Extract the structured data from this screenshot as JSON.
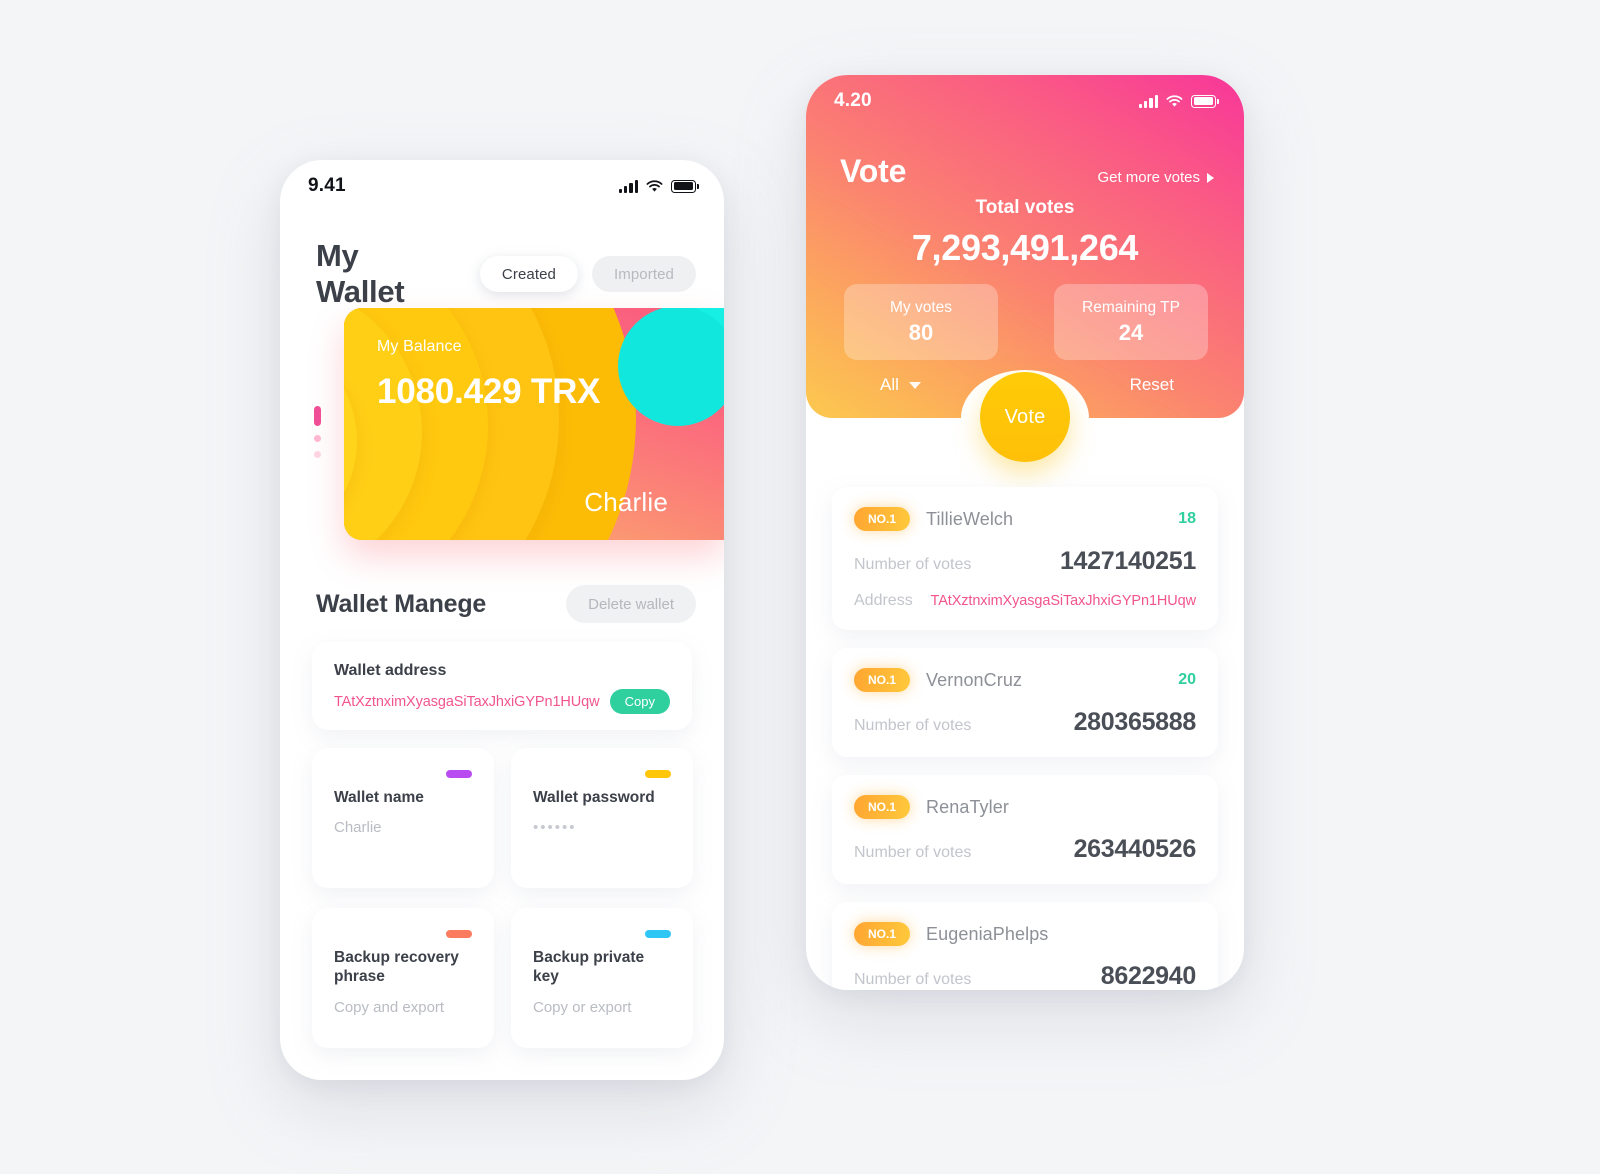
{
  "wallet_screen": {
    "status_bar": {
      "time": "9.41",
      "signal": "signal-bars-icon",
      "wifi": "wifi-icon",
      "battery": "battery-icon"
    },
    "title": "My Wallet",
    "tabs": [
      {
        "label": "Created",
        "active": true
      },
      {
        "label": "Imported",
        "active": false
      }
    ],
    "balance_card": {
      "label": "My Balance",
      "amount": "1080.429 TRX",
      "owner": "Charlie"
    },
    "pagination": {
      "total": 3,
      "active_index": 0
    },
    "manage": {
      "title": "Wallet Manege",
      "delete_label": "Delete wallet"
    },
    "address_card": {
      "label": "Wallet address",
      "value": "TAtXztnximXyasgaSiTaxJhxiGYPn1HUqw",
      "copy_label": "Copy"
    },
    "mini_cards": [
      {
        "title": "Wallet name",
        "sub": "Charlie",
        "dash_color": "#b84cf0",
        "is_password": false
      },
      {
        "title": "Wallet password",
        "sub": "••••••",
        "dash_color": "#ffc60a",
        "is_password": true
      },
      {
        "title": "Backup recovery phrase",
        "sub": "Copy and export",
        "dash_color": "#fb7b5e",
        "is_password": false
      },
      {
        "title": "Backup private key",
        "sub": "Copy or export",
        "dash_color": "#2ec6f5",
        "is_password": false
      }
    ]
  },
  "vote_screen": {
    "status_bar": {
      "time": "4.20",
      "signal": "signal-bars-icon",
      "wifi": "wifi-icon",
      "battery": "battery-icon"
    },
    "title": "Vote",
    "get_more_label": "Get more votes",
    "total_label": "Total votes",
    "total_value": "7,293,491,264",
    "stats": [
      {
        "label": "My votes",
        "value": "80"
      },
      {
        "label": "Remaining TP",
        "value": "24"
      }
    ],
    "filter_label": "All",
    "reset_label": "Reset",
    "vote_button_label": "Vote",
    "votes_key_label": "Number of votes",
    "address_key_label": "Address",
    "list": [
      {
        "rank": "NO.1",
        "name": "TillieWelch",
        "input_value": "18",
        "votes": "1427140251",
        "address": "TAtXztnximXyasgaSiTaxJhxiGYPn1HUqw"
      },
      {
        "rank": "NO.1",
        "name": "VernonCruz",
        "input_value": "20",
        "votes": "280365888",
        "address": ""
      },
      {
        "rank": "NO.1",
        "name": "RenaTyler",
        "input_value": "",
        "votes": "263440526",
        "address": ""
      },
      {
        "rank": "NO.1",
        "name": "EugeniaPhelps",
        "input_value": "",
        "votes": "8622940",
        "address": ""
      }
    ]
  },
  "colors": {
    "accent_pink": "#f2558e",
    "accent_green": "#2fcf9e",
    "accent_yellow": "#ffc60a",
    "card_gradient_start": "#fa5c7f",
    "card_gradient_end": "#fcb96c",
    "header_gradient_start": "#f8369a",
    "header_gradient_end": "#fdc94f",
    "cyan": "#12e7de",
    "background": "#f4f5f7"
  }
}
